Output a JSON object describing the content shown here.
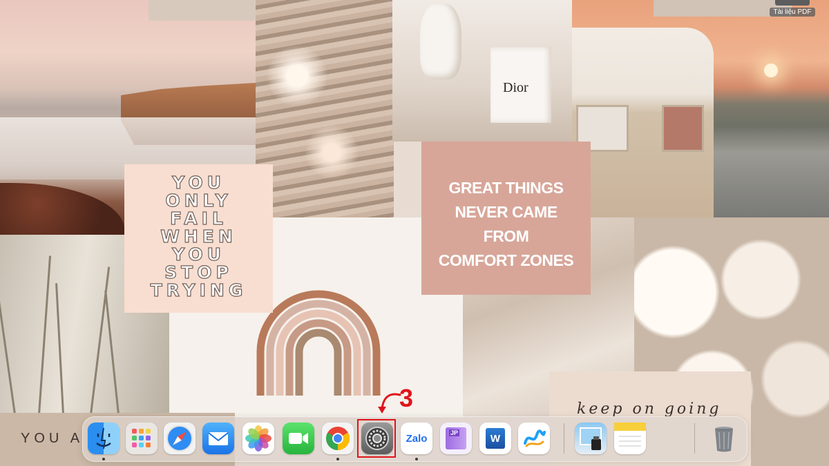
{
  "wallpaper": {
    "quote_left_lines": [
      "YOU",
      "ONLY",
      "FAIL",
      "WHEN",
      "YOU",
      "STOP",
      "TRYING"
    ],
    "quote_right_lines": [
      "GREAT THINGS",
      "NEVER CAME",
      "FROM",
      "COMFORT ZONES"
    ],
    "bag_brand": "Dior",
    "bottom_left_text": "YOU  A",
    "script_text": "keep  on  going"
  },
  "desktop": {
    "file_label": "Tài liệu PDF"
  },
  "annotation": {
    "step_number": "3",
    "color": "#e0141b"
  },
  "dock": {
    "apps": [
      {
        "name": "Finder",
        "icon": "finder-icon",
        "running": true
      },
      {
        "name": "Launchpad",
        "icon": "launchpad-icon",
        "running": false
      },
      {
        "name": "Safari",
        "icon": "safari-icon",
        "running": false
      },
      {
        "name": "Mail",
        "icon": "mail-icon",
        "running": false
      },
      {
        "name": "Photos",
        "icon": "photos-icon",
        "running": false
      },
      {
        "name": "FaceTime",
        "icon": "facetime-icon",
        "running": false
      },
      {
        "name": "Google Chrome",
        "icon": "chrome-icon",
        "running": true
      },
      {
        "name": "System Settings",
        "icon": "settings-gear-icon",
        "running": false,
        "highlighted": true
      },
      {
        "name": "Zalo",
        "icon": "zalo-icon",
        "label": "Zalo",
        "running": true
      },
      {
        "name": "Japanese Dictionary",
        "icon": "dictionary-icon",
        "label": "JP",
        "running": false
      },
      {
        "name": "Microsoft Word",
        "icon": "word-icon",
        "label": "W",
        "running": false
      },
      {
        "name": "Freeform",
        "icon": "freeform-icon",
        "running": false
      },
      {
        "name": "Preview",
        "icon": "preview-icon",
        "running": false
      },
      {
        "name": "Notes",
        "icon": "notes-icon",
        "running": false
      },
      {
        "name": "Trash",
        "icon": "trash-icon",
        "running": false
      }
    ]
  }
}
